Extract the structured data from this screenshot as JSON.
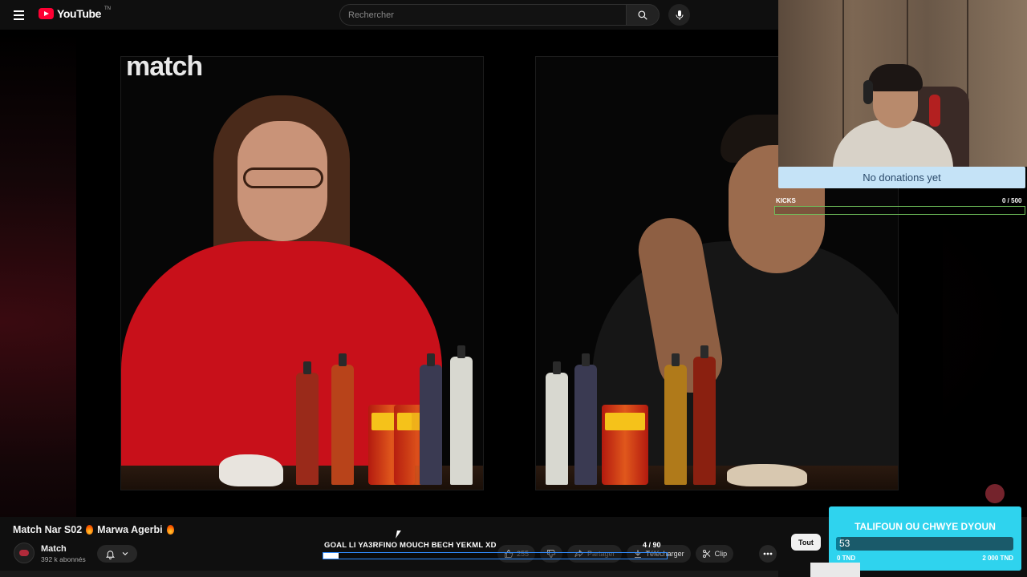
{
  "header": {
    "logo_text": "YouTube",
    "logo_region": "TN",
    "search_placeholder": "Rechercher",
    "icons": [
      "menu-icon",
      "search-icon",
      "mic-icon"
    ]
  },
  "video": {
    "brand_watermark": "match",
    "title": "Match Nar S02",
    "guest": "Marwa Agerbi",
    "channel": {
      "name": "Match",
      "subscribers": "392 k abonnés"
    }
  },
  "stream_overlay": {
    "donations_text": "No donations yet",
    "kicks": {
      "label": "KICKS",
      "count": "0  / 500",
      "progress": 0
    },
    "goal": {
      "text": "GOAL LI YA3RFINO MOUCH BECH YEKML XD",
      "count": "4  / 90",
      "progress": 0.044
    },
    "goal_card": {
      "title": "TALIFOUN OU CHWYE DYOUN",
      "value": "53",
      "min": "0 TND",
      "max": "2 000 TND",
      "progress": 0.0265
    }
  },
  "actions": {
    "likes": "255",
    "share_label": "Partager",
    "download_label": "Télécharger",
    "clip_label": "Clip"
  },
  "filters": {
    "all_label": "Tout"
  },
  "colors": {
    "youtube_red": "#ff0033",
    "donation_bg": "#c5e3f7",
    "kicks_green": "#6fbf5a",
    "goal_card_cyan": "#2fd3ee",
    "goal_bar_blue": "#2f8cff"
  }
}
